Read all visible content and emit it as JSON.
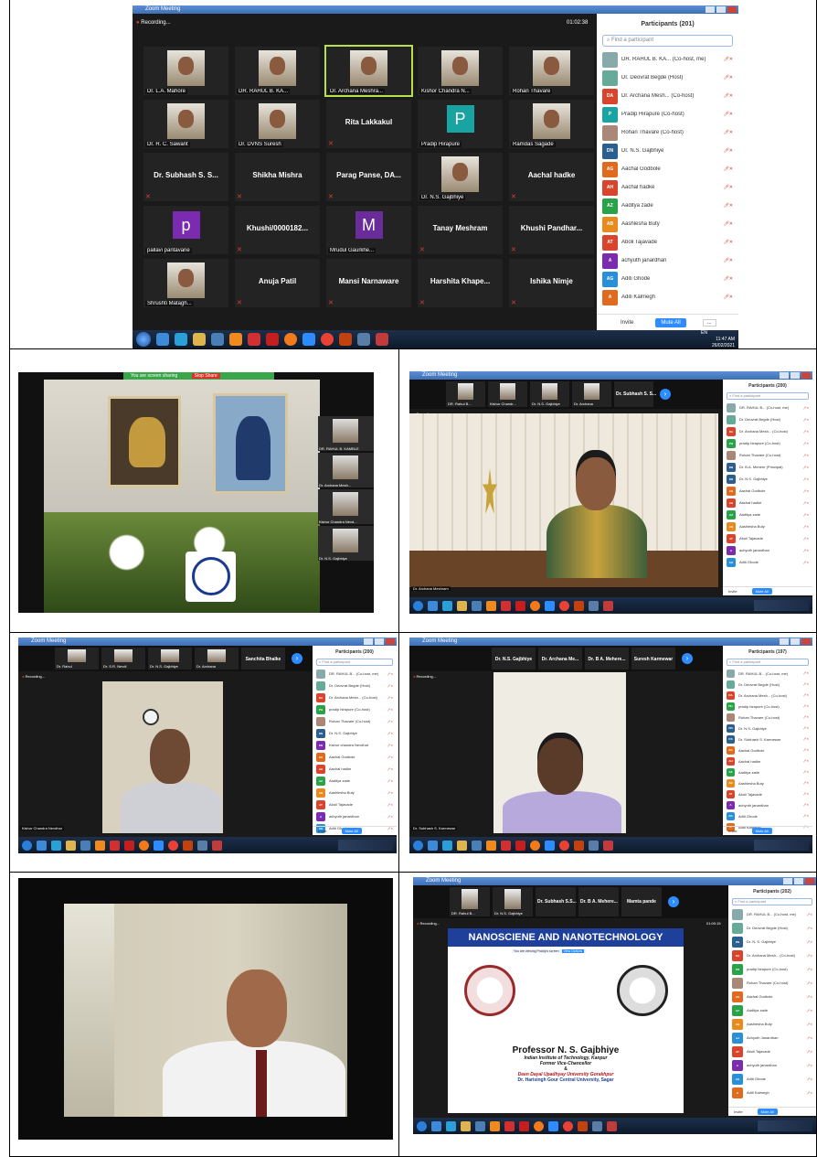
{
  "colors": {
    "zoom_bg": "#1a1a1a",
    "accent_blue": "#2d8cff",
    "mute_red": "#d0342c"
  },
  "screen1": {
    "window_title": "Zoom Meeting",
    "recording": "Recording...",
    "timer": "01:02:38",
    "panel_title": "Participants (201)",
    "search_placeholder": "Find a participant",
    "invite": "Invite",
    "mute_all": "Mute All",
    "more": "...",
    "tray_time": "11:47 AM",
    "tray_date": "26/02/2021",
    "tray_lang": "EN",
    "tiles": [
      {
        "name": "Dr. L.A. Mahore",
        "kind": "video"
      },
      {
        "name": "DR. RAHUL B. KA...",
        "kind": "video"
      },
      {
        "name": "Dr. Archana Meshra...",
        "kind": "video",
        "active": true
      },
      {
        "name": "Kishor Chandra N...",
        "kind": "video"
      },
      {
        "name": "Rohan Thavare",
        "kind": "video"
      },
      {
        "name": "Dr. R. C. Sawant",
        "kind": "video"
      },
      {
        "name": "Dr. DVNS Suresh",
        "kind": "video"
      },
      {
        "name": "Rita Lakkakul",
        "kind": "text"
      },
      {
        "name": "Pradip Hirapure",
        "kind": "letter",
        "letter": "P",
        "color": "#1aa3a3"
      },
      {
        "name": "Ramdas Sagade",
        "kind": "video"
      },
      {
        "name": "Dr. Subhash S. S...",
        "kind": "text"
      },
      {
        "name": "Shikha Mishra",
        "kind": "text"
      },
      {
        "name": "Parag Panse, DA...",
        "kind": "text"
      },
      {
        "name": "Dr. N.S. Gajbhiye",
        "kind": "video"
      },
      {
        "name": "Aachal hadke",
        "kind": "text"
      },
      {
        "name": "pallavi pantavane",
        "kind": "letter",
        "letter": "p",
        "color": "#7b2bb0"
      },
      {
        "name": "Khushi/0000182...",
        "kind": "text"
      },
      {
        "name": "Mrudul Gaurkhe...",
        "kind": "letter",
        "letter": "M",
        "color": "#6a2c9a"
      },
      {
        "name": "Tanay Meshram",
        "kind": "text"
      },
      {
        "name": "Khushi Pandhar...",
        "kind": "text"
      },
      {
        "name": "Shrushti Matagh...",
        "kind": "video"
      },
      {
        "name": "Anuja Patil",
        "kind": "text"
      },
      {
        "name": "Mansi Narnaware",
        "kind": "text"
      },
      {
        "name": "Harshita Khape...",
        "kind": "text"
      },
      {
        "name": "Ishika Nimje",
        "kind": "text"
      }
    ],
    "participants": [
      {
        "name": "DR. RAHUL B. KA... (Co-host, me)",
        "av": "img",
        "color": "#8aa"
      },
      {
        "name": "Dr. Deovrat Begde (Host)",
        "av": "img",
        "color": "#6a9"
      },
      {
        "name": "Dr. Archana Mesh... (Co-host)",
        "av": "DA",
        "color": "#d9452c"
      },
      {
        "name": "Pradip Hirapure (Co-host)",
        "av": "P",
        "color": "#1aa3a3"
      },
      {
        "name": "Rohan Thavare (Co-host)",
        "av": "img",
        "color": "#a87"
      },
      {
        "name": "Dr. N.S. Gajbhiye",
        "av": "DN",
        "color": "#2a5f8f"
      },
      {
        "name": "Aachal Godbole",
        "av": "AG",
        "color": "#e06a1e"
      },
      {
        "name": "Aachal hadke",
        "av": "AH",
        "color": "#d9452c"
      },
      {
        "name": "Aaditya zade",
        "av": "AZ",
        "color": "#2aa24a"
      },
      {
        "name": "Aashlesha Buty",
        "av": "AB",
        "color": "#e88b1e"
      },
      {
        "name": "Aboli Tajavade",
        "av": "AT",
        "color": "#d9452c"
      },
      {
        "name": "achyuth janardhan",
        "av": "A",
        "color": "#7b2bb0"
      },
      {
        "name": "Aditi Ghode",
        "av": "AG",
        "color": "#2a8fd9"
      },
      {
        "name": "Aditi Kalmegh",
        "av": "A",
        "color": "#e06a1e"
      }
    ]
  },
  "screen2": {
    "banner": "You are screen sharing",
    "stop_share": "Stop Share",
    "thumbs": [
      "DR. RAHUL B. KAMBLE",
      "Dr. Archana Mesh...",
      "Kishor Chandra Nevd...",
      "Dr. N.S. Gajbhiye"
    ]
  },
  "screen3": {
    "window_title": "Zoom Meeting",
    "top_names": [
      "DR. Rahul B...",
      "Kishor Chandr...",
      "Dr. N.S. Gajbhiye",
      "Dr. Archana",
      "Dr. Subhash S. S..."
    ],
    "recording": "Recording...",
    "panel_title": "Participants (200)",
    "search_placeholder": "Find a participant",
    "speaker_label": "Dr. Archana Meshram",
    "invite": "Invite",
    "mute_all": "Mute All",
    "participants": [
      {
        "name": "DR. RAHUL B... (Co-host, me)",
        "av": "img",
        "color": "#8aa"
      },
      {
        "name": "Dr. Deovrat Begde (Host)",
        "av": "img",
        "color": "#6a9"
      },
      {
        "name": "Dr. Archana Mesh... (Co-host)",
        "av": "DA",
        "color": "#d9452c"
      },
      {
        "name": "pradip hirapure (Co-host)",
        "av": "PH",
        "color": "#2aa24a"
      },
      {
        "name": "Rohan Thavare (Co-host)",
        "av": "img",
        "color": "#a87"
      },
      {
        "name": "Dr. B.A. Mehere (Principal)",
        "av": "DB",
        "color": "#2a5f8f"
      },
      {
        "name": "Dr. N.S. Gajbhiye",
        "av": "DN",
        "color": "#2a5f8f"
      },
      {
        "name": "Aachal Godbole",
        "av": "AG",
        "color": "#e06a1e"
      },
      {
        "name": "Aachal hadke",
        "av": "AH",
        "color": "#d9452c"
      },
      {
        "name": "Aaditya zade",
        "av": "AZ",
        "color": "#2aa24a"
      },
      {
        "name": "Aashlesha Buty",
        "av": "AB",
        "color": "#e88b1e"
      },
      {
        "name": "Aboli Tajavade",
        "av": "AT",
        "color": "#d9452c"
      },
      {
        "name": "achyuth janardhan",
        "av": "A",
        "color": "#7b2bb0"
      },
      {
        "name": "Aditi Ghode",
        "av": "AG",
        "color": "#2a8fd9"
      }
    ]
  },
  "screen4": {
    "window_title": "Zoom Meeting",
    "top_names": [
      "Dr. Rahul",
      "Dr. S.R. Nevdi",
      "Dr. N.S. Gajbhiye",
      "Dr. Archana",
      "Sanchita Bhalke"
    ],
    "recording": "Recording...",
    "panel_title": "Participants (200)",
    "search_placeholder": "Find a participant",
    "speaker_label": "Kishor Chandra Nevdhar",
    "invite": "Invite",
    "mute_all": "Mute All",
    "participants": [
      {
        "name": "DR. RAHUL B... (Co-host, me)",
        "av": "img",
        "color": "#8aa"
      },
      {
        "name": "Dr. Deovrat Begde (Host)",
        "av": "img",
        "color": "#6a9"
      },
      {
        "name": "Dr. Archana Mesh... (Co-host)",
        "av": "DA",
        "color": "#d9452c"
      },
      {
        "name": "pradip hirapure (Co-host)",
        "av": "PH",
        "color": "#2aa24a"
      },
      {
        "name": "Rohan Thavare (Co-host)",
        "av": "img",
        "color": "#a87"
      },
      {
        "name": "Dr. N.S. Gajbhiye",
        "av": "DN",
        "color": "#2a5f8f"
      },
      {
        "name": "Kishor chandra Nevdhar",
        "av": "KN",
        "color": "#7b2bb0"
      },
      {
        "name": "Aachal Godbole",
        "av": "AG",
        "color": "#e06a1e"
      },
      {
        "name": "Aachal hadke",
        "av": "AH",
        "color": "#d9452c"
      },
      {
        "name": "Aaditya zade",
        "av": "AZ",
        "color": "#2aa24a"
      },
      {
        "name": "Aashlesha Buty",
        "av": "AB",
        "color": "#e88b1e"
      },
      {
        "name": "Aboli Tajavade",
        "av": "AT",
        "color": "#d9452c"
      },
      {
        "name": "achyuth janardhan",
        "av": "A",
        "color": "#7b2bb0"
      },
      {
        "name": "Aditi Ghode",
        "av": "AG",
        "color": "#2a8fd9"
      }
    ]
  },
  "screen5": {
    "window_title": "Zoom Meeting",
    "top_names": [
      "Dr. N.S. Gajbhiye",
      "Dr. Archana Me...",
      "Dr. B A. Mehere...",
      "Suresh Karmewar"
    ],
    "recording": "Recording...",
    "panel_title": "Participants (197)",
    "search_placeholder": "Find a participant",
    "speaker_label": "Dr. Subhash S. Karmewar",
    "invite": "Invite",
    "mute_all": "Mute All",
    "participants": [
      {
        "name": "DR. RAHUL B... (Co-host, me)",
        "av": "img",
        "color": "#8aa"
      },
      {
        "name": "Dr. Deovrat Begde (Host)",
        "av": "img",
        "color": "#6a9"
      },
      {
        "name": "Dr. Archana Mesh... (Co-host)",
        "av": "DA",
        "color": "#d9452c"
      },
      {
        "name": "pradip hirapure (Co-host)",
        "av": "PH",
        "color": "#2aa24a"
      },
      {
        "name": "Rohan Thavare (Co-host)",
        "av": "img",
        "color": "#a87"
      },
      {
        "name": "Dr. N.S. Gajbhiye",
        "av": "DN",
        "color": "#2a5f8f"
      },
      {
        "name": "Dr. Subhash S. Karmewar",
        "av": "DS",
        "color": "#2a5f8f"
      },
      {
        "name": "Aachal Godbole",
        "av": "AG",
        "color": "#e06a1e"
      },
      {
        "name": "Aachal hadke",
        "av": "AH",
        "color": "#d9452c"
      },
      {
        "name": "Aaditya zade",
        "av": "AZ",
        "color": "#2aa24a"
      },
      {
        "name": "Aashlesha Buty",
        "av": "AB",
        "color": "#e88b1e"
      },
      {
        "name": "Aboli Tajavade",
        "av": "AT",
        "color": "#d9452c"
      },
      {
        "name": "achyuth janardhan",
        "av": "A",
        "color": "#7b2bb0"
      },
      {
        "name": "Aditi Ghode",
        "av": "AG",
        "color": "#2a8fd9"
      },
      {
        "name": "Aditi Kalmegh",
        "av": "A",
        "color": "#e06a1e"
      }
    ]
  },
  "screen7": {
    "window_title": "Zoom Meeting",
    "top_names": [
      "DR. Rahul B...",
      "Dr. N.S. Gajbhiye",
      "Dr. Subhash S.S...",
      "Dr. B A. Mehere...",
      "Mamta pande"
    ],
    "recording": "Recording...",
    "timer": "01:00:15",
    "panel_title": "Participants (202)",
    "search_placeholder": "Find a participant",
    "slide_title": "NANOSCIENE AND NANOTECHNOLOGY",
    "share_note": "You are viewing Pradip's screen",
    "view_options": "View Options",
    "prof_name": "Professor N. S. Gajbhiye",
    "prof_line1": "Indian Institute of Technology, Kanpur",
    "prof_line2": "Former Vice-Chancellor",
    "prof_amp": "&",
    "prof_line3": "Deen Dayal Upadhyay University Gorakhpur",
    "prof_line4": "Dr. Harisingh Gour Central University, Sagar",
    "invite": "Invite",
    "mute_all": "Mute All",
    "participants": [
      {
        "name": "DR. RAHUL B... (Co-host, me)",
        "av": "img",
        "color": "#8aa"
      },
      {
        "name": "Dr. Deovrat Begde (Host)",
        "av": "img",
        "color": "#6a9"
      },
      {
        "name": "Dr. N. S. Gajbhiye",
        "av": "DN",
        "color": "#2a5f8f"
      },
      {
        "name": "Dr. Archana Mesh... (Co-host)",
        "av": "DA",
        "color": "#d9452c"
      },
      {
        "name": "pradip hirapure (Co-host)",
        "av": "PH",
        "color": "#2aa24a"
      },
      {
        "name": "Rohan Thavare (Co-host)",
        "av": "img",
        "color": "#a87"
      },
      {
        "name": "Aachal Godbole",
        "av": "AG",
        "color": "#e06a1e"
      },
      {
        "name": "Aaditya zade",
        "av": "AZ",
        "color": "#2aa24a"
      },
      {
        "name": "Aashlesha Buty",
        "av": "AB",
        "color": "#e88b1e"
      },
      {
        "name": "Achyuth Janardhan",
        "av": "AJ",
        "color": "#2a8fd9"
      },
      {
        "name": "Aboli Tajavade",
        "av": "AT",
        "color": "#d9452c"
      },
      {
        "name": "achyuth janardhan",
        "av": "A",
        "color": "#7b2bb0"
      },
      {
        "name": "Aditi Ghode",
        "av": "AG",
        "color": "#2a8fd9"
      },
      {
        "name": "Aditi Kalmegh",
        "av": "A",
        "color": "#e06a1e"
      }
    ]
  }
}
